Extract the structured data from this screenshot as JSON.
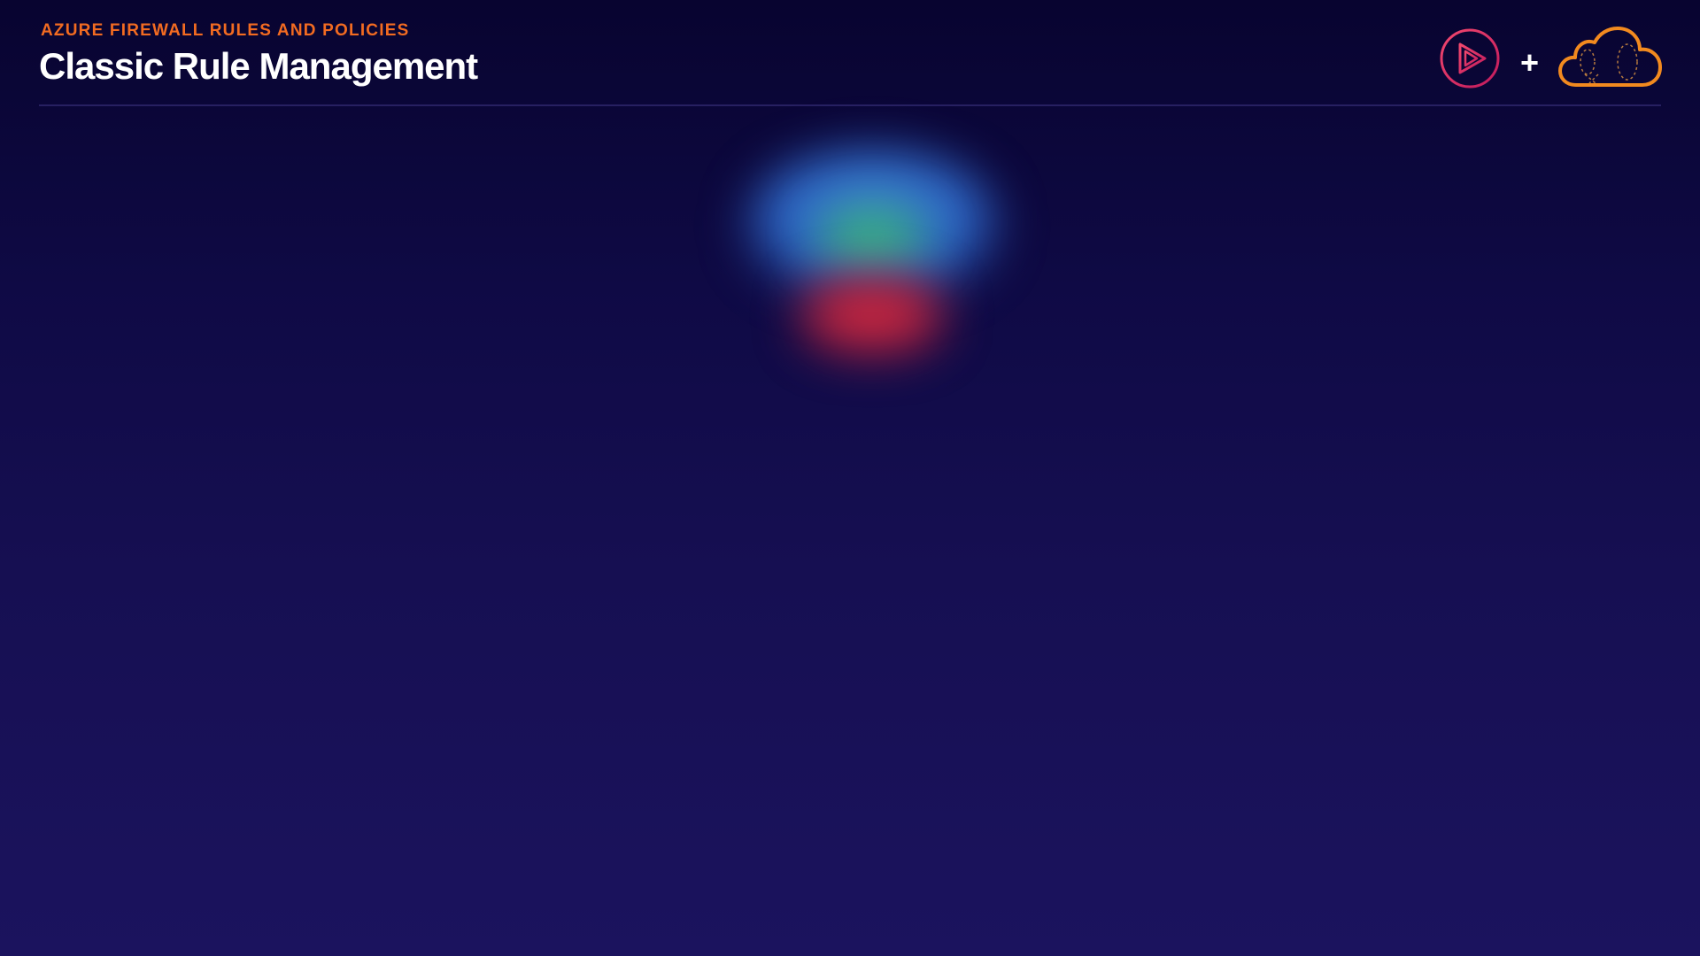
{
  "header": {
    "eyebrow": "AZURE FIREWALL RULES AND POLICIES",
    "title": "Classic Rule Management"
  },
  "logos": {
    "left_icon": "play-circle-icon",
    "separator": "+",
    "right_icon": "cloud-icon"
  },
  "colors": {
    "accent_orange": "#f26b21",
    "play_pink": "#e0245e",
    "background_top": "#080430",
    "background_bottom": "#1b135e",
    "blob_blue": "#3c7fd8",
    "blob_green": "#47c48a",
    "blob_red": "#d12a43"
  }
}
